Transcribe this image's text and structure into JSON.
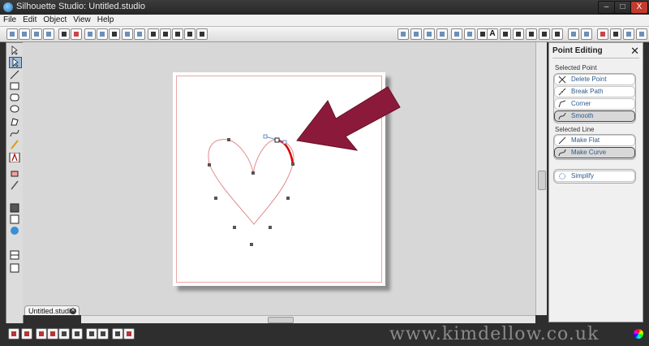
{
  "window": {
    "title": "Silhouette Studio: Untitled.studio",
    "minimize": "–",
    "maximize": "□",
    "close": "X"
  },
  "menu": {
    "items": [
      "File",
      "Edit",
      "Object",
      "View",
      "Help"
    ]
  },
  "document_tab": {
    "label": "Untitled.studio"
  },
  "toolbar": {
    "text_tool_glyph": "A"
  },
  "panel": {
    "title": "Point Editing",
    "close_glyph": "✕",
    "selected_point_label": "Selected Point",
    "selected_point_buttons": [
      {
        "label": "Delete Point",
        "icon": "delete-point-icon",
        "selected": false
      },
      {
        "label": "Break Path",
        "icon": "break-path-icon",
        "selected": false
      },
      {
        "label": "Corner",
        "icon": "corner-icon",
        "selected": false
      },
      {
        "label": "Smooth",
        "icon": "smooth-icon",
        "selected": true
      }
    ],
    "selected_line_label": "Selected Line",
    "selected_line_buttons": [
      {
        "label": "Make Flat",
        "icon": "make-flat-icon",
        "selected": false
      },
      {
        "label": "Make Curve",
        "icon": "make-curve-icon",
        "selected": true
      }
    ],
    "simplify_label": "Simplify"
  },
  "watermark": "www.kimdellow.co.uk",
  "colors": {
    "accent": "#8b1a3a",
    "cut_line": "#e08a8a",
    "selected_segment": "#dd0000",
    "button_text": "#2f5b8a"
  }
}
